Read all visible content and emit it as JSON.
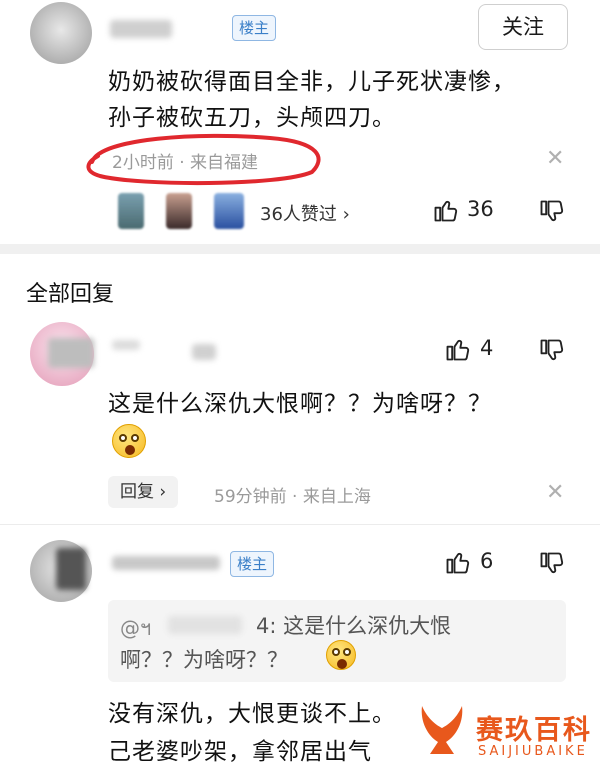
{
  "comment": {
    "badge": "楼主",
    "follow_label": "关注",
    "text_line1": "奶奶被砍得面目全非，儿子死状凄惨，",
    "text_line2": "孙子被砍五刀，头颅四刀。",
    "meta": "2小时前 · 来自福建",
    "likers_label": "36人赞过 ›",
    "like_count": "36",
    "highlight_color": "#e0282e"
  },
  "section_title": "全部回复",
  "replies": [
    {
      "text_line1": "这是什么深仇大恨啊？？为啥呀？？",
      "like_count": "4",
      "reply_label": "回复 ›",
      "meta": "59分钟前 · 来自上海"
    },
    {
      "badge": "楼主",
      "like_count": "6",
      "quote_prefix": "@ฯ",
      "quote_line1": "4:  这是什么深仇大恨",
      "quote_line2": "啊？？为啥呀？？",
      "text_line1": "没有深仇，大恨更谈不上。",
      "text_line2": "己老婆吵架，拿邻居出气"
    }
  ],
  "watermark": {
    "name": "赛玖百科",
    "sub": "SAIJIUBAIKE",
    "color": "#e8581c"
  },
  "icons": [
    "thumbs-up-icon",
    "thumbs-down-icon",
    "close-icon",
    "surprised-emoji-icon",
    "watermark-logo-icon"
  ]
}
